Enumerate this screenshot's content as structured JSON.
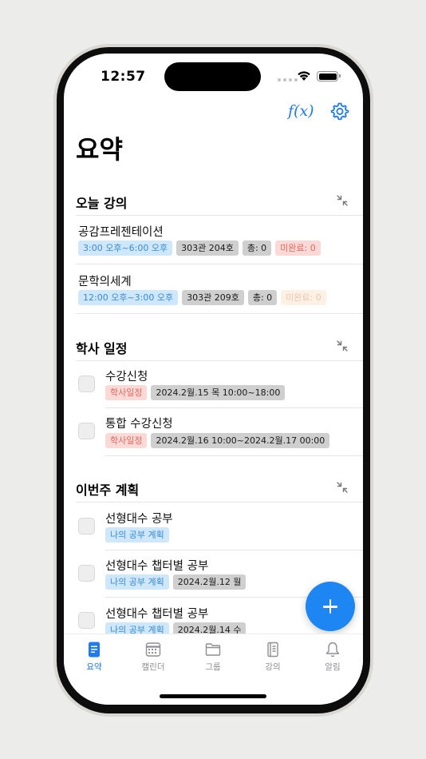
{
  "status_bar": {
    "time": "12:57"
  },
  "toolbar": {
    "formula_label": "f(x)"
  },
  "page_title": "요약",
  "sections": {
    "today": {
      "title": "오늘 강의",
      "items": [
        {
          "title": "공감프레젠테이션",
          "time": "3:00 오후~6:00 오후",
          "room": "303관 204호",
          "total": "총: 0",
          "incomplete": "미완료: 0"
        },
        {
          "title": "문학의세계",
          "time": "12:00 오후~3:00 오후",
          "room": "303관 209호",
          "total": "총: 0",
          "incomplete": "미완료: 0"
        }
      ]
    },
    "academic": {
      "title": "학사 일정",
      "items": [
        {
          "title": "수강신청",
          "tag": "학사일정",
          "date": "2024.2월.15 목 10:00~18:00"
        },
        {
          "title": "통합 수강신청",
          "tag": "학사일정",
          "date": "2024.2월.16 10:00~2024.2월.17 00:00"
        }
      ]
    },
    "weekly": {
      "title": "이번주 계획",
      "items": [
        {
          "title": "선형대수 공부",
          "tag": "나의 공부 계획"
        },
        {
          "title": "선형대수 챕터별 공부",
          "tag": "나의 공부 계획",
          "date": "2024.2월.12 월"
        },
        {
          "title": "선형대수 챕터별 공부",
          "tag": "나의 공부 계획",
          "date": "2024.2월.14 수"
        }
      ]
    }
  },
  "tabs": [
    {
      "label": "요약",
      "icon": "summary-icon",
      "active": true
    },
    {
      "label": "캘린더",
      "icon": "calendar-icon"
    },
    {
      "label": "그룹",
      "icon": "folder-icon"
    },
    {
      "label": "강의",
      "icon": "notebook-icon"
    },
    {
      "label": "알림",
      "icon": "bell-icon"
    }
  ],
  "colors": {
    "accent": "#1f7bf0",
    "fab": "#1d86f2",
    "chip_blue": "#cfe7fb",
    "chip_gray": "#cfcfcf",
    "chip_red": "#fbd9d6"
  }
}
